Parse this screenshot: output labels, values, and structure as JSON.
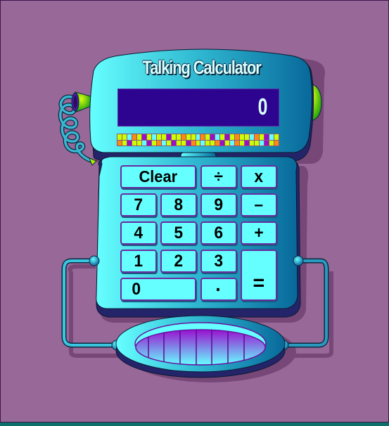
{
  "app": {
    "title": "Talking Calculator",
    "display_value": "0"
  },
  "colors": {
    "background": "#986898",
    "display_bg": "#2c0490",
    "key_fill": "#66ffff",
    "key_border": "#6a2aa0",
    "body_light": "#66ffff",
    "body_dark": "#0a6a9a",
    "accent_green": "#aaf000"
  },
  "beads": {
    "row1": [
      "y",
      "y",
      "c",
      "o",
      "y",
      "p",
      "y",
      "c",
      "y",
      "y",
      "p",
      "y",
      "y",
      "o",
      "y",
      "y",
      "c",
      "o",
      "y",
      "p",
      "c",
      "y",
      "p",
      "y",
      "o",
      "y",
      "y",
      "c",
      "o",
      "y",
      "p",
      "c",
      "y"
    ],
    "row2": [
      "o",
      "y",
      "p",
      "y",
      "y",
      "c",
      "p",
      "y",
      "o",
      "c",
      "y",
      "p",
      "y",
      "y",
      "p",
      "o",
      "y",
      "c",
      "y",
      "y",
      "o",
      "p",
      "y",
      "c",
      "o",
      "y",
      "p",
      "y",
      "y",
      "c",
      "p",
      "y",
      "o"
    ]
  },
  "keys": {
    "clear": "Clear",
    "divide": "÷",
    "multiply": "x",
    "seven": "7",
    "eight": "8",
    "nine": "9",
    "minus": "–",
    "four": "4",
    "five": "5",
    "six": "6",
    "plus": "+",
    "one": "1",
    "two": "2",
    "three": "3",
    "equals": "=",
    "zero": "0",
    "decimal": "·"
  },
  "icons": {
    "left_ear": "green-cone-speaker-with-coiled-cord",
    "right_button": "green-dome-button",
    "speaker": "oval-speaker-grille"
  }
}
